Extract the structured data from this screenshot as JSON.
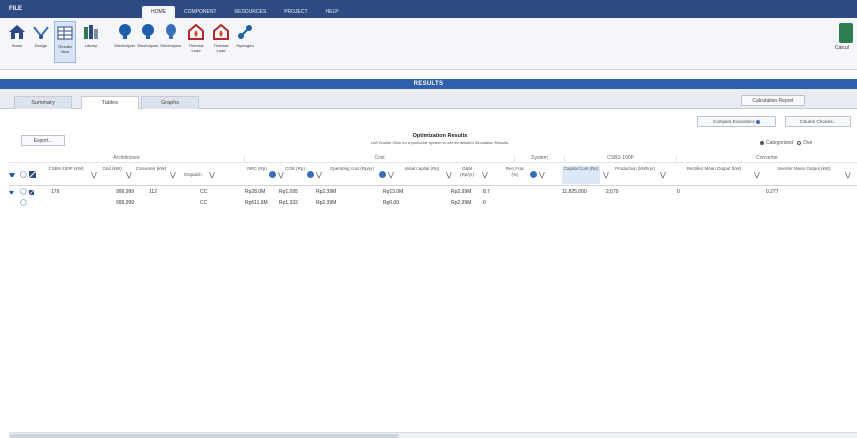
{
  "menu": {
    "file": "FILE",
    "tabs": [
      "HOME",
      "COMPONENT",
      "RESOURCES",
      "PROJECT",
      "HELP"
    ],
    "active_tab": "HOME"
  },
  "ribbon": {
    "buttons": [
      {
        "label": "Home",
        "icon": "home-icon"
      },
      {
        "label": "Design",
        "icon": "design-icon"
      },
      {
        "label": "Results View",
        "icon": "results-icon"
      },
      {
        "label": "Library",
        "icon": "library-icon"
      },
      {
        "label": "Electrolyzer",
        "icon": "electrolyzer-icon"
      },
      {
        "label": "Electrolyzer",
        "icon": "electrolyzer-icon"
      },
      {
        "label": "Electrolyzer",
        "icon": "electrolyzer-icon"
      },
      {
        "label": "Thermal Load",
        "icon": "thermal-icon"
      },
      {
        "label": "Thermal Load",
        "icon": "thermal-icon"
      },
      {
        "label": "Hydrogen",
        "icon": "hydrogen-icon"
      }
    ],
    "calculate": "Calcul"
  },
  "results_header": "RESULTS",
  "subtabs": [
    "Summary",
    "Tables",
    "Graphs"
  ],
  "active_subtab": "Tables",
  "calc_report": "Calculation Report",
  "compare_economics": "Compare Economics",
  "column_choices": "Column Choices...",
  "export": "Export...",
  "optimization_title": "Optimization Results",
  "optimization_sub": "Left Double Click on a particular system to see its detailed Simulation Results.",
  "view_toggle": {
    "categorized": "Categorized",
    "overall": "Ove"
  },
  "groups": [
    "Architecture",
    "Cost",
    "System",
    "CSBS-100P",
    "Converter"
  ],
  "columns": [
    "CSBS-100P (kW)",
    "Grid (kW)",
    "Converter (kW)",
    "Dispatch",
    "NPC (Rp)",
    "COE (Rp)",
    "Operating cost (Rp/yr)",
    "Initial capital (Rp)",
    "O&M (Rp/yr)",
    "Ren Frac (%)",
    "Capital Cost (Rp)",
    "Production (kWh/yr)",
    "Rectifier Mean Output (kW)",
    "Inverter Mean Output (kW)"
  ],
  "rows": [
    [
      "179",
      "999,999",
      "112",
      "CC",
      "Rp28.0M",
      "Rp1,095",
      "Rp2.39M",
      "Rp13.0M",
      "Rp2.39M",
      "8.7",
      "11,825,000",
      "2,570",
      "0",
      "0.277"
    ],
    [
      "",
      "999,999",
      "",
      "CC",
      "Rp611.6M",
      "Rp1,332",
      "Rp2.39M",
      "Rp0.00",
      "Rp2.39M",
      "0",
      "",
      "",
      "",
      ""
    ]
  ],
  "colors": {
    "menubar": "#2e4a82",
    "results_bar": "#2f5fae",
    "ribbon": "#f4f6f9",
    "accent": "#3a6fb7"
  }
}
